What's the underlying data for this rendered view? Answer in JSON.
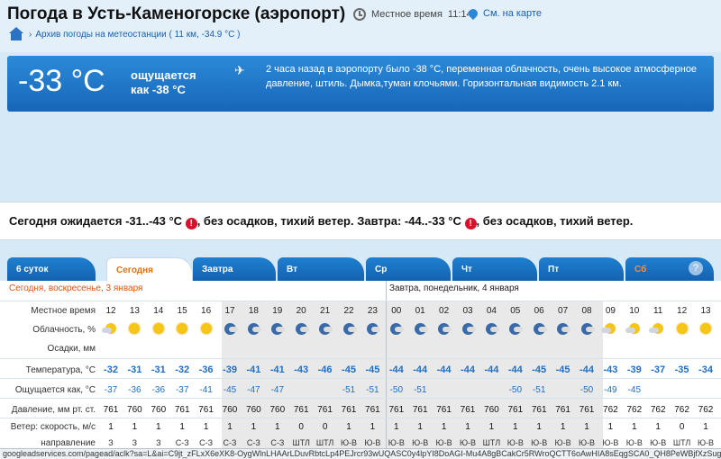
{
  "header": {
    "title": "Погода в Усть-Каменогорске (аэропорт)",
    "localtime_label": "Местное время",
    "localtime_value": "11:14",
    "map_link": "См. на карте",
    "archive_link": "Архив погоды на метеостанции ( 11 км, -34.9 °C )"
  },
  "current": {
    "temperature": "-33 °C",
    "feels_label": "ощущается",
    "feels_value": "как -38 °C",
    "description": "2 часа назад в аэропорту было -38 °C, переменная облачность, очень высокое атмосферное давление, штиль. Дымка,туман клочьями. Горизонтальная видимость 2.1 км."
  },
  "summary": {
    "today": "Сегодня ожидается -31..-43 °C",
    "today_rest": ", без осадков, тихий ветер. Завтра: -44..-33 °C",
    "tomorrow_rest": ", без осадков, тихий ветер."
  },
  "tabs": [
    {
      "label": "6 суток"
    },
    {
      "label": "Сегодня"
    },
    {
      "label": "Завтра"
    },
    {
      "label": "Вт"
    },
    {
      "label": "Ср"
    },
    {
      "label": "Чт"
    },
    {
      "label": "Пт"
    },
    {
      "label": "Сб"
    }
  ],
  "help": "?",
  "table": {
    "today_header": "Сегодня, воскресенье, 3 января",
    "tomorrow_header": "Завтра, понедельник, 4 января",
    "labels": {
      "time": "Местное время",
      "cloud": "Облачность, %",
      "precip": "Осадки, мм",
      "temp": "Температура, °C",
      "feels": "Ощущается как, °C",
      "press": "Давление, мм рт. ст.",
      "wind": "Ветер: скорость, м/с",
      "dir": "направление"
    },
    "hours": [
      "12",
      "13",
      "14",
      "15",
      "16",
      "17",
      "18",
      "19",
      "20",
      "21",
      "22",
      "23",
      "00",
      "01",
      "02",
      "03",
      "04",
      "05",
      "06",
      "07",
      "08",
      "09",
      "10",
      "11",
      "12",
      "13"
    ],
    "cloud": [
      "suncloud",
      "sun",
      "sun",
      "sun",
      "sun",
      "moon",
      "moon",
      "moon",
      "moon",
      "moon",
      "moon",
      "moon",
      "moon",
      "moon",
      "moon",
      "moon",
      "moon",
      "moon",
      "moon",
      "moon",
      "moon",
      "suncloud",
      "suncloud",
      "suncloud",
      "sun",
      "sun"
    ],
    "temp": [
      "-32",
      "-31",
      "-31",
      "-32",
      "-36",
      "-39",
      "-41",
      "-41",
      "-43",
      "-46",
      "-45",
      "-45",
      "-44",
      "-44",
      "-44",
      "-44",
      "-44",
      "-44",
      "-45",
      "-45",
      "-44",
      "-43",
      "-39",
      "-37",
      "-35",
      "-34"
    ],
    "feels": [
      "-37",
      "-36",
      "-36",
      "-37",
      "-41",
      "-45",
      "-47",
      "-47",
      "",
      "",
      "-51",
      "-51",
      "-50",
      "-51",
      "",
      "",
      "",
      "-50",
      "-51",
      "",
      "-50",
      "-49",
      "-45",
      "",
      "",
      ""
    ],
    "press": [
      "761",
      "760",
      "760",
      "761",
      "761",
      "760",
      "760",
      "760",
      "761",
      "761",
      "761",
      "761",
      "761",
      "761",
      "761",
      "761",
      "760",
      "761",
      "761",
      "761",
      "761",
      "762",
      "762",
      "762",
      "762",
      "762"
    ],
    "wind": [
      "1",
      "1",
      "1",
      "1",
      "1",
      "1",
      "1",
      "1",
      "0",
      "0",
      "1",
      "1",
      "1",
      "1",
      "1",
      "1",
      "1",
      "1",
      "1",
      "1",
      "1",
      "1",
      "1",
      "1",
      "0",
      "1"
    ],
    "dir": [
      "З",
      "З",
      "З",
      "С-З",
      "С-З",
      "С-З",
      "С-З",
      "С-З",
      "ШТЛ",
      "ШТЛ",
      "Ю-В",
      "Ю-В",
      "Ю-В",
      "Ю-В",
      "Ю-В",
      "Ю-В",
      "ШТЛ",
      "Ю-В",
      "Ю-В",
      "Ю-В",
      "Ю-В",
      "Ю-В",
      "Ю-В",
      "Ю-В",
      "ШТЛ",
      "Ю-В"
    ]
  },
  "status_url": "googleadservices.com/pagead/aclk?sa=L&ai=C9jt_zFLxX6eXK8-OygWlnLHAArLDuvRbtcLp4PEJrcr93wUQASC0y4lpYI8DoAGI-Mu4A8gBCakCr5RWroQCTT6oAwHIA8sEqgSCA0_QH8PeWBjfXzSug4h"
}
